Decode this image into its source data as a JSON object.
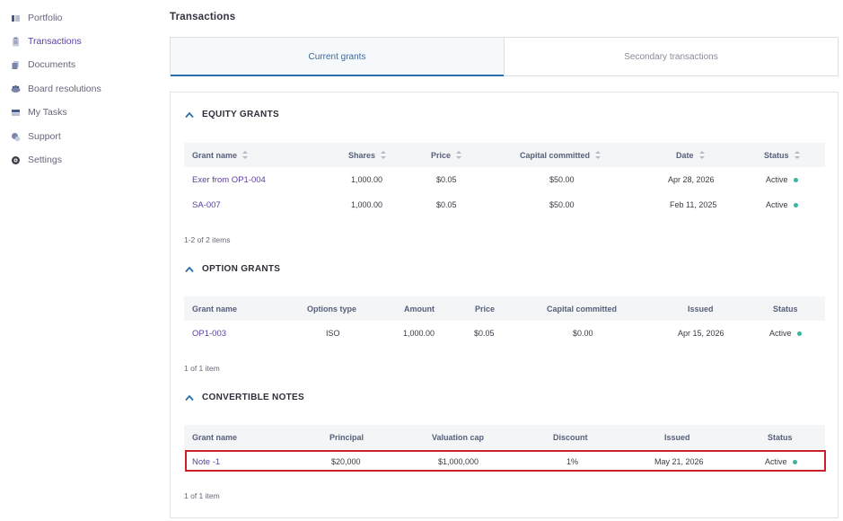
{
  "sidebar": {
    "items": [
      {
        "label": "Portfolio",
        "icon": "portfolio-icon"
      },
      {
        "label": "Transactions",
        "icon": "clipboard-icon"
      },
      {
        "label": "Documents",
        "icon": "documents-icon"
      },
      {
        "label": "Board resolutions",
        "icon": "board-icon"
      },
      {
        "label": "My Tasks",
        "icon": "tasks-icon"
      },
      {
        "label": "Support",
        "icon": "support-icon"
      },
      {
        "label": "Settings",
        "icon": "gear-icon"
      }
    ],
    "active_index": 1
  },
  "page": {
    "title": "Transactions"
  },
  "tabs": [
    {
      "label": "Current grants",
      "active": true
    },
    {
      "label": "Secondary transactions",
      "active": false
    }
  ],
  "colors": {
    "accent": "#5a3fa0",
    "tab_underline": "#2a6fad",
    "status_active": "#3db39e",
    "highlight": "#c8202d"
  },
  "equity": {
    "title": "EQUITY GRANTS",
    "headers": [
      "Grant name",
      "Shares",
      "Price",
      "Capital committed",
      "Date",
      "Status"
    ],
    "rows": [
      [
        "Exer from OP1-004",
        "1,000.00",
        "$0.05",
        "$50.00",
        "Apr 28, 2026",
        "Active"
      ],
      [
        "SA-007",
        "1,000.00",
        "$0.05",
        "$50.00",
        "Feb 11, 2025",
        "Active"
      ]
    ],
    "count": "1-2 of 2 items"
  },
  "options": {
    "title": "OPTION GRANTS",
    "headers": [
      "Grant name",
      "Options type",
      "Amount",
      "Price",
      "Capital committed",
      "Issued",
      "Status"
    ],
    "rows": [
      [
        "OP1-003",
        "ISO",
        "1,000.00",
        "$0.05",
        "$0.00",
        "Apr 15, 2026",
        "Active"
      ]
    ],
    "count": "1 of 1 item"
  },
  "notes": {
    "title": "CONVERTIBLE NOTES",
    "headers": [
      "Grant name",
      "Principal",
      "Valuation cap",
      "Discount",
      "Issued",
      "Status"
    ],
    "rows": [
      [
        "Note -1",
        "$20,000",
        "$1,000,000",
        "1%",
        "May 21, 2026",
        "Active"
      ]
    ],
    "count": "1 of 1 item"
  }
}
